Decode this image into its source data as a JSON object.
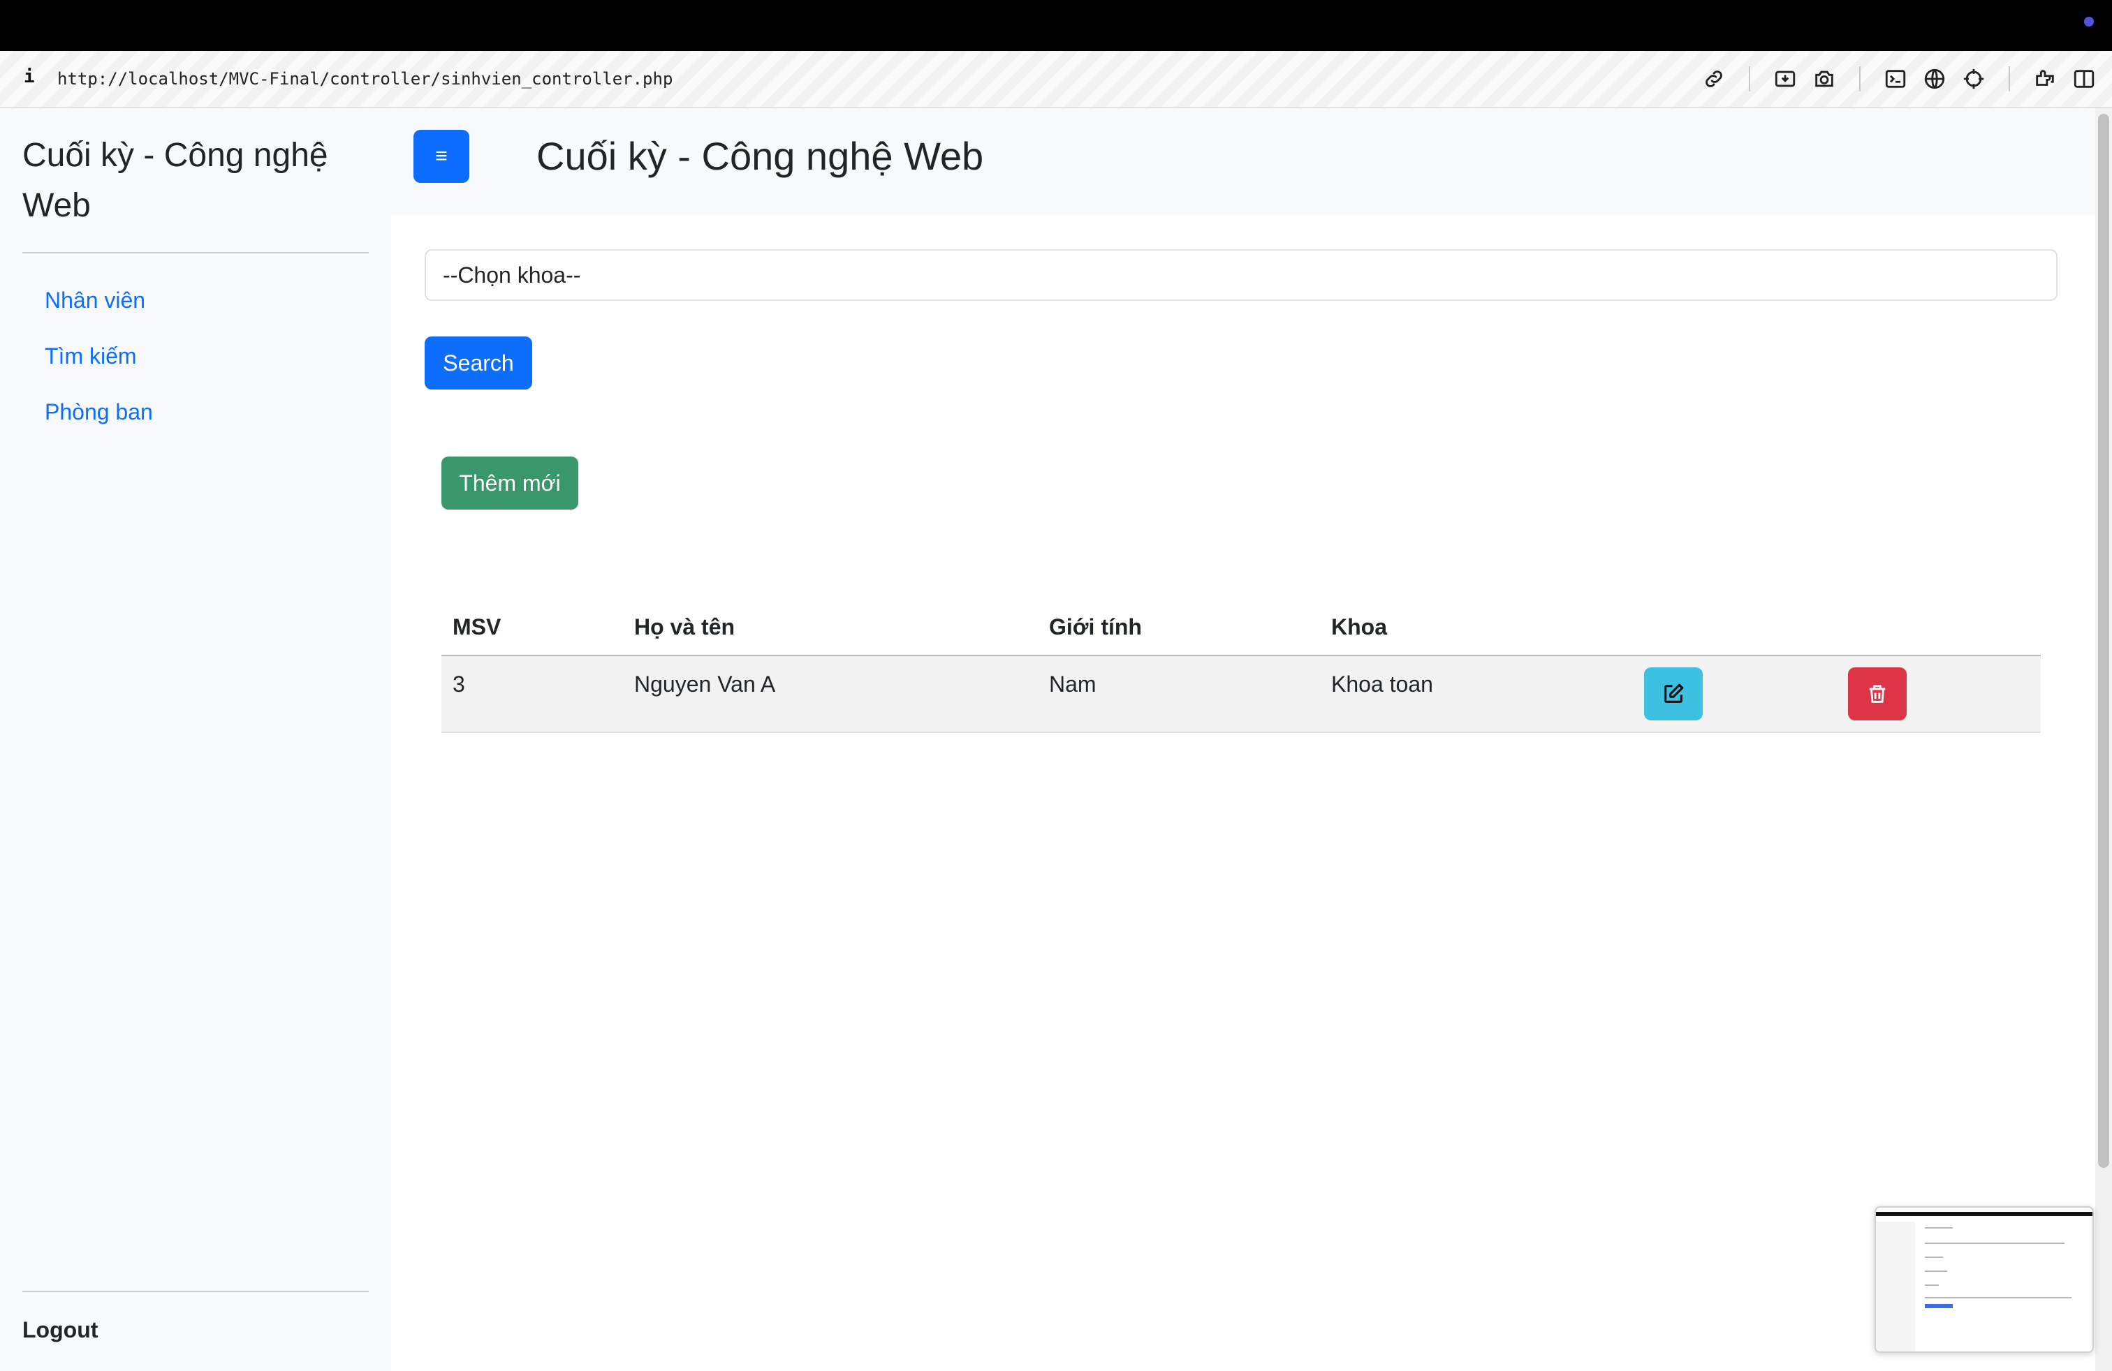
{
  "browser": {
    "url_info": "i",
    "url": "http://localhost/MVC-Final/controller/sinhvien_controller.php",
    "toolbar_icons": [
      "link-icon",
      "screenshot-area-icon",
      "camera-icon",
      "terminal-icon",
      "globe-icon",
      "crosshair-icon",
      "extensions-icon",
      "sidebar-icon"
    ]
  },
  "sidebar": {
    "brand": "Cuối kỳ - Công nghệ Web",
    "nav": [
      {
        "label": "Nhân viên"
      },
      {
        "label": "Tìm kiếm"
      },
      {
        "label": "Phòng ban"
      }
    ],
    "logout": "Logout"
  },
  "header": {
    "menu_icon": "≡",
    "title": "Cuối kỳ - Công nghệ Web"
  },
  "filter": {
    "select_value": "--Chọn khoa--",
    "search_label": "Search"
  },
  "add_label": "Thêm mới",
  "table": {
    "columns": [
      "MSV",
      "Họ và tên",
      "Giới tính",
      "Khoa"
    ],
    "rows": [
      {
        "msv": "3",
        "name": "Nguyen Van A",
        "gender": "Nam",
        "faculty": "Khoa toan"
      }
    ]
  },
  "colors": {
    "primary": "#0d6efd",
    "success": "#198754",
    "info": "#3dc1e3",
    "danger": "#dc3545",
    "sidebar_bg": "#f8f9fa"
  }
}
